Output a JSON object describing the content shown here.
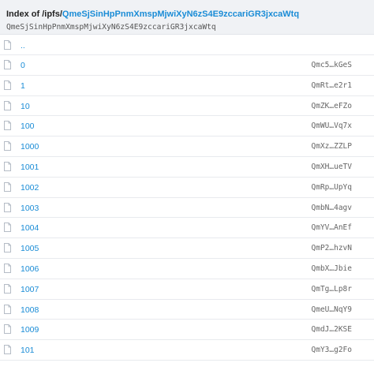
{
  "header": {
    "index_prefix": "Index of /ipfs/",
    "path_link": "QmeSjSinHpPnmXmspMjwiXyN6zS4E9zccariGR3jxcaWtq",
    "cid": "QmeSjSinHpPnmXmspMjwiXyN6zS4E9zccariGR3jxcaWtq"
  },
  "rows": [
    {
      "name": "..",
      "hash": ""
    },
    {
      "name": "0",
      "hash": "Qmc5…kGeS"
    },
    {
      "name": "1",
      "hash": "QmRt…e2r1"
    },
    {
      "name": "10",
      "hash": "QmZK…eFZo"
    },
    {
      "name": "100",
      "hash": "QmWU…Vq7x"
    },
    {
      "name": "1000",
      "hash": "QmXz…ZZLP"
    },
    {
      "name": "1001",
      "hash": "QmXH…ueTV"
    },
    {
      "name": "1002",
      "hash": "QmRp…UpYq"
    },
    {
      "name": "1003",
      "hash": "QmbN…4agv"
    },
    {
      "name": "1004",
      "hash": "QmYV…AnEf"
    },
    {
      "name": "1005",
      "hash": "QmP2…hzvN"
    },
    {
      "name": "1006",
      "hash": "QmbX…Jbie"
    },
    {
      "name": "1007",
      "hash": "QmTg…Lp8r"
    },
    {
      "name": "1008",
      "hash": "QmeU…NqY9"
    },
    {
      "name": "1009",
      "hash": "QmdJ…2KSE"
    },
    {
      "name": "101",
      "hash": "QmY3…g2Fo"
    }
  ],
  "icons": {
    "file": "file-icon"
  },
  "colors": {
    "link": "#1a8cd6",
    "header_bg": "#f0f2f5"
  }
}
